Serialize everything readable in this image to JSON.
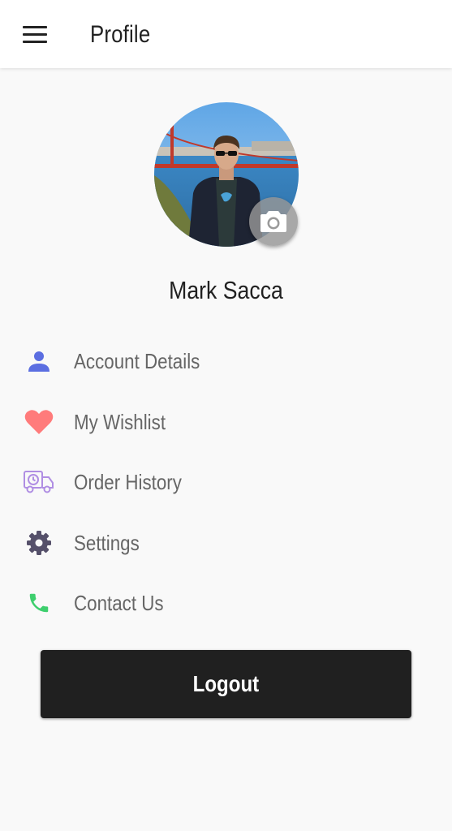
{
  "header": {
    "title": "Profile",
    "menu_icon": "hamburger-menu-icon"
  },
  "profile": {
    "name": "Mark Sacca",
    "camera_icon": "camera-icon"
  },
  "menu": {
    "items": [
      {
        "label": "Account Details",
        "icon": "person-icon",
        "color": "#5b6ee1"
      },
      {
        "label": "My Wishlist",
        "icon": "heart-icon",
        "color": "#ff7b7b"
      },
      {
        "label": "Order History",
        "icon": "delivery-truck-icon",
        "color": "#b08ee3"
      },
      {
        "label": "Settings",
        "icon": "gear-icon",
        "color": "#55506a"
      },
      {
        "label": "Contact Us",
        "icon": "phone-icon",
        "color": "#3ecf6e"
      }
    ]
  },
  "logout": {
    "label": "Logout"
  },
  "colors": {
    "appbar": "#ffffff",
    "background": "#f9f9f9",
    "button": "#202020",
    "label": "#666666"
  }
}
